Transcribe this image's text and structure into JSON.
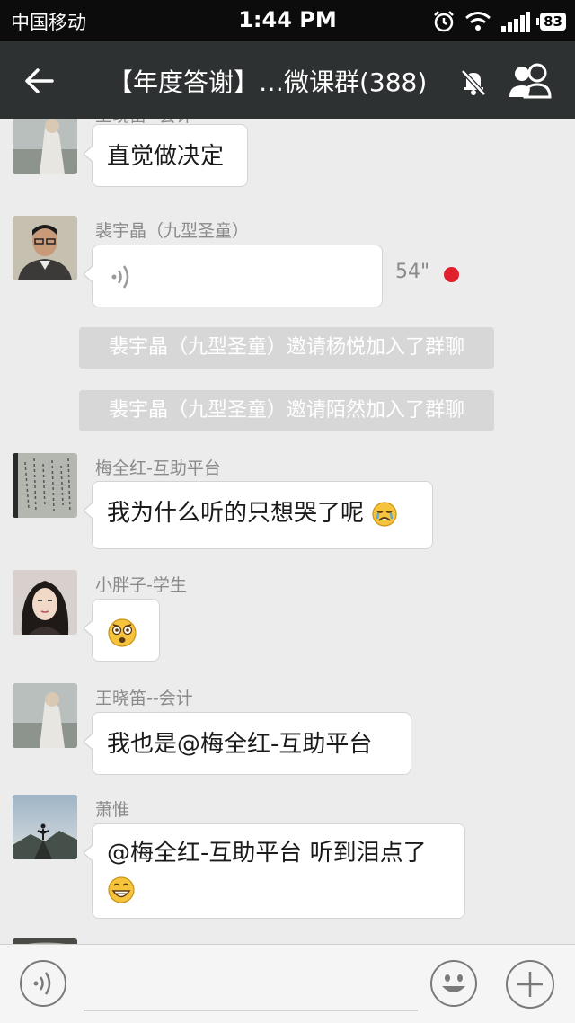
{
  "status_bar": {
    "carrier": "中国移动",
    "time": "1:44 PM",
    "battery": "83"
  },
  "nav": {
    "title": "【年度答谢】…微课群(388)",
    "back_icon": "back-arrow-icon",
    "mute_icon": "bell-muted-icon",
    "members_icon": "group-members-icon"
  },
  "messages": [
    {
      "sender": "王晓笛--会计",
      "text": "直觉做决定"
    },
    {
      "sender": "裴宇晶（九型圣童）",
      "type": "voice",
      "duration": "54\""
    },
    {
      "sender": "梅全红-互助平台",
      "text": "我为什么听的只想哭了呢"
    },
    {
      "sender": "小胖子-学生",
      "text": ""
    },
    {
      "sender": "王晓笛--会计",
      "text": "我也是@梅全红-互助平台"
    },
    {
      "sender": "萧惟",
      "text": "@梅全红-互助平台 听到泪点了"
    }
  ],
  "system_notices": [
    "裴宇晶（九型圣童）邀请杨悦加入了群聊",
    "裴宇晶（九型圣童）邀请陌然加入了群聊"
  ],
  "input_bar": {
    "voice_icon": "voice-toggle-icon",
    "emoji_icon": "smiley-icon",
    "plus_icon": "plus-icon"
  },
  "colors": {
    "nav_bg": "#2e3132",
    "chat_bg": "#ececec",
    "unread_dot": "#e0202c"
  }
}
